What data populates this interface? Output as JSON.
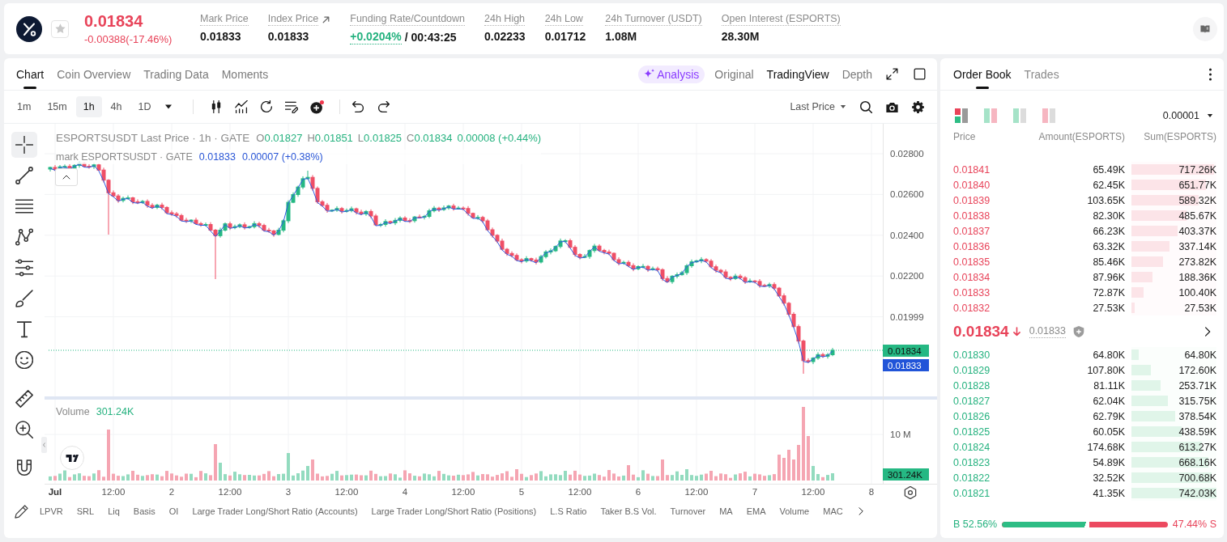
{
  "header": {
    "starred": false,
    "price": "0.01834",
    "change": "-0.00388(-17.46%)",
    "stats": [
      {
        "kind": "plain",
        "label": "Mark Price",
        "value": "0.01833"
      },
      {
        "kind": "link",
        "label": "Index Price",
        "value": "0.01833"
      },
      {
        "kind": "funding",
        "label": "Funding Rate/Countdown",
        "rate": "+0.0204%",
        "countdown": "/ 00:43:25"
      },
      {
        "kind": "plain",
        "label": "24h High",
        "value": "0.02233"
      },
      {
        "kind": "plain",
        "label": "24h Low",
        "value": "0.01712"
      },
      {
        "kind": "plain",
        "label": "24h Turnover (USDT)",
        "value": "1.08M"
      },
      {
        "kind": "plain",
        "label": "Open Interest (ESPORTS)",
        "value": "28.30M"
      }
    ]
  },
  "chart_panel": {
    "tabs": [
      {
        "label": "Chart",
        "selected": true
      },
      {
        "label": "Coin Overview",
        "selected": false
      },
      {
        "label": "Trading Data",
        "selected": false
      },
      {
        "label": "Moments",
        "selected": false
      }
    ],
    "ai_button": {
      "label": "Analysis"
    },
    "view_modes": [
      {
        "label": "Original",
        "selected": false
      },
      {
        "label": "TradingView",
        "selected": true
      },
      {
        "label": "Depth",
        "selected": false
      }
    ],
    "intervals": [
      {
        "label": "1m",
        "selected": false
      },
      {
        "label": "15m",
        "selected": false
      },
      {
        "label": "1h",
        "selected": true
      },
      {
        "label": "4h",
        "selected": false
      },
      {
        "label": "1D",
        "selected": false
      }
    ],
    "price_source": "Last Price",
    "tool_groups": [
      {
        "tools": [
          {
            "kind": "crosshair",
            "selected": true
          },
          {
            "kind": "trend-line",
            "selected": false
          },
          {
            "kind": "horizontal-lines",
            "selected": false
          },
          {
            "kind": "pattern",
            "selected": false
          },
          {
            "kind": "levels",
            "selected": false
          },
          {
            "kind": "brush",
            "selected": false
          },
          {
            "kind": "text",
            "selected": false
          },
          {
            "kind": "emoji",
            "selected": false
          }
        ]
      },
      {
        "tools": [
          {
            "kind": "ruler",
            "selected": false
          },
          {
            "kind": "zoom",
            "selected": false
          }
        ]
      },
      {
        "tools": [
          {
            "kind": "magnet",
            "selected": false
          }
        ]
      }
    ],
    "legend": {
      "title": "ESPORTSUSDT Last Price · 1h · GATE",
      "ohlc": [
        {
          "key": "O",
          "value": "0.01827"
        },
        {
          "key": "H",
          "value": "0.01851"
        },
        {
          "key": "L",
          "value": "0.01825"
        },
        {
          "key": "C",
          "value": "0.01834"
        }
      ],
      "change": "0.00008 (+0.44%)",
      "mark_title": "mark ESPORTSUSDT · GATE",
      "mark_price": "0.01833",
      "mark_change": "0.00007 (+0.38%)"
    },
    "price_axis": [
      "0.02800",
      "0.02600",
      "0.02400",
      "0.02200",
      "0.01999"
    ],
    "last_price_badge": "0.01834",
    "mark_price_badge": "0.01833",
    "volume": {
      "label": "Volume",
      "value": "301.24K",
      "axis_label": "10 M",
      "badge": "301.24K"
    },
    "time_axis": [
      {
        "label": "Jul",
        "kind": "month"
      },
      {
        "label": "12:00",
        "kind": "hour"
      },
      {
        "label": "2",
        "kind": "day"
      },
      {
        "label": "12:00",
        "kind": "hour"
      },
      {
        "label": "3",
        "kind": "day"
      },
      {
        "label": "12:00",
        "kind": "hour"
      },
      {
        "label": "4",
        "kind": "day"
      },
      {
        "label": "12:00",
        "kind": "hour"
      },
      {
        "label": "5",
        "kind": "day"
      },
      {
        "label": "12:00",
        "kind": "hour"
      },
      {
        "label": "6",
        "kind": "day"
      },
      {
        "label": "12:00",
        "kind": "hour"
      },
      {
        "label": "7",
        "kind": "day"
      },
      {
        "label": "12:00",
        "kind": "hour"
      },
      {
        "label": "8",
        "kind": "day"
      }
    ],
    "indicators": [
      "LPVR",
      "SRL",
      "Liq",
      "Basis",
      "OI",
      "Large Trader Long/Short Ratio (Accounts)",
      "Large Trader Long/Short Ratio (Positions)",
      "L.S Ratio",
      "Taker B.S Vol.",
      "Turnover",
      "MA",
      "EMA",
      "Volume",
      "MAC"
    ]
  },
  "order_book": {
    "tabs": [
      {
        "label": "Order Book",
        "selected": true
      },
      {
        "label": "Trades",
        "selected": false
      }
    ],
    "views": [
      {
        "kind": "stacked",
        "selected": true
      },
      {
        "kind": "split",
        "selected": false
      },
      {
        "kind": "bids",
        "selected": false
      },
      {
        "kind": "asks",
        "selected": false
      }
    ],
    "precision": "0.00001",
    "columns": [
      "Price",
      "Amount(ESPORTS)",
      "Sum(ESPORTS)"
    ],
    "asks": [
      {
        "price": "0.01841",
        "amount": "65.49K",
        "sum": "717.26K",
        "level": 0.97
      },
      {
        "price": "0.01840",
        "amount": "62.45K",
        "sum": "651.77K",
        "level": 0.88
      },
      {
        "price": "0.01839",
        "amount": "103.65K",
        "sum": "589.32K",
        "level": 0.79
      },
      {
        "price": "0.01838",
        "amount": "82.30K",
        "sum": "485.67K",
        "level": 0.65
      },
      {
        "price": "0.01837",
        "amount": "66.23K",
        "sum": "403.37K",
        "level": 0.54
      },
      {
        "price": "0.01836",
        "amount": "63.32K",
        "sum": "337.14K",
        "level": 0.45
      },
      {
        "price": "0.01835",
        "amount": "85.46K",
        "sum": "273.82K",
        "level": 0.37
      },
      {
        "price": "0.01834",
        "amount": "87.96K",
        "sum": "188.36K",
        "level": 0.25
      },
      {
        "price": "0.01833",
        "amount": "72.87K",
        "sum": "100.40K",
        "level": 0.14
      },
      {
        "price": "0.01832",
        "amount": "27.53K",
        "sum": "27.53K",
        "level": 0.04
      }
    ],
    "last": {
      "price": "0.01834",
      "falling": true,
      "mark": "0.01833"
    },
    "bids": [
      {
        "price": "0.01830",
        "amount": "64.80K",
        "sum": "64.80K",
        "level": 0.09
      },
      {
        "price": "0.01829",
        "amount": "107.80K",
        "sum": "172.60K",
        "level": 0.23
      },
      {
        "price": "0.01828",
        "amount": "81.11K",
        "sum": "253.71K",
        "level": 0.34
      },
      {
        "price": "0.01827",
        "amount": "62.04K",
        "sum": "315.75K",
        "level": 0.43
      },
      {
        "price": "0.01826",
        "amount": "62.79K",
        "sum": "378.54K",
        "level": 0.51
      },
      {
        "price": "0.01825",
        "amount": "60.05K",
        "sum": "438.59K",
        "level": 0.59
      },
      {
        "price": "0.01824",
        "amount": "174.68K",
        "sum": "613.27K",
        "level": 0.83
      },
      {
        "price": "0.01823",
        "amount": "54.89K",
        "sum": "668.16K",
        "level": 0.9
      },
      {
        "price": "0.01822",
        "amount": "32.52K",
        "sum": "700.68K",
        "level": 0.94
      },
      {
        "price": "0.01821",
        "amount": "41.35K",
        "sum": "742.03K",
        "level": 1
      }
    ],
    "ratio": {
      "buy": "B 52.56%",
      "sell": "47.44% S",
      "level": 0.5256
    }
  }
}
